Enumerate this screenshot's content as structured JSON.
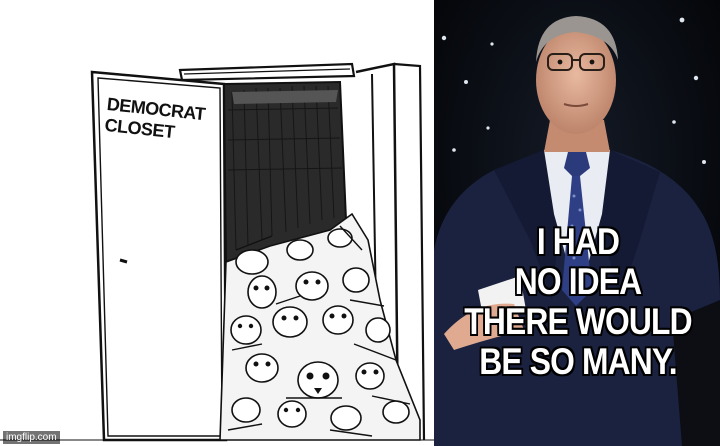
{
  "meme": {
    "left_label": "DEMOCRAT\nCLOSET",
    "right_caption": "I HAD\nNO IDEA\nTHERE WOULD\nBE SO MANY.",
    "watermark": "imgflip.com"
  },
  "colors": {
    "ink": "#111111",
    "background_left": "#ffffff",
    "background_right": "#05070c",
    "suit": "#1b2240",
    "caption_text": "#ffffff"
  },
  "icons": [
    "closet-door-illustration",
    "skulls-and-bones-pile",
    "man-in-suit-photo"
  ]
}
